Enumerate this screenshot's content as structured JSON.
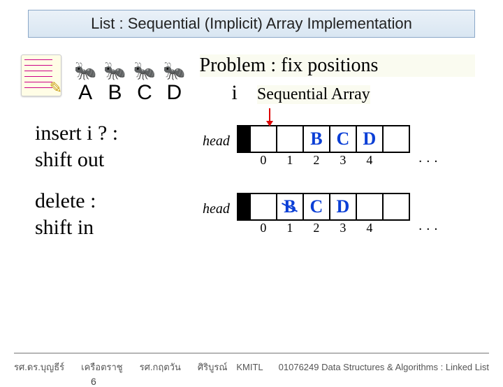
{
  "title": "List : Sequential (Implicit) Array Implementation",
  "ants": {
    "letters": [
      "A",
      "B",
      "C",
      "D"
    ]
  },
  "problem": "Problem : fix positions",
  "i_label": "i",
  "seq_label": "Sequential Array",
  "insert": {
    "line1": "insert i ? :",
    "line2": " shift out"
  },
  "delete": {
    "line1": "delete :",
    "line2": "shift in"
  },
  "array": {
    "head": "head",
    "insert_cells": [
      "",
      "",
      "B",
      "C",
      "D",
      ""
    ],
    "delete_cells": [
      "",
      "B",
      "C",
      "D",
      "",
      ""
    ],
    "strike_idx": 1,
    "strike_val": "B",
    "indices": [
      "0",
      "1",
      "2",
      "3",
      "4"
    ],
    "dots": ". . ."
  },
  "footer": {
    "a": "รศ.ดร.บุญธีร์",
    "b": "เครือตราชู",
    "c": "รศ.กฤตวัน",
    "d": "ศิริบูรณ์",
    "inst": "KMITL",
    "course": "01076249 Data Structures & Algorithms : Linked List",
    "page": "6"
  }
}
